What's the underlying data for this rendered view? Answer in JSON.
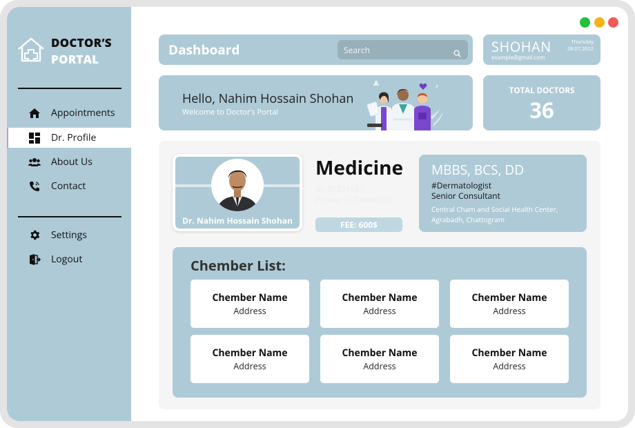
{
  "window_controls": [
    {
      "name": "maximize",
      "color": "#22c03c"
    },
    {
      "name": "minimize",
      "color": "#f5b21c"
    },
    {
      "name": "close",
      "color": "#f25a5a"
    }
  ],
  "brand": {
    "line1": "DOCTOR’S",
    "line2": "PORTAL",
    "icon": "house-cross-icon"
  },
  "sidebar": {
    "main_nav": [
      {
        "label": "Appointments",
        "icon": "home-icon",
        "active": false
      },
      {
        "label": "Dr. Profile",
        "icon": "dashboard-grid-icon",
        "active": true
      },
      {
        "label": "About Us",
        "icon": "users-icon",
        "active": false
      },
      {
        "label": "Contact",
        "icon": "phone-icon",
        "active": false
      }
    ],
    "bottom_nav": [
      {
        "label": "Settings",
        "icon": "gear-icon"
      },
      {
        "label": "Logout",
        "icon": "logout-icon"
      }
    ]
  },
  "header": {
    "title": "Dashboard",
    "search_placeholder": "Search"
  },
  "user": {
    "name": "SHOHAN",
    "email": "example@gmail.com",
    "day": "Thursday",
    "date": "28.07.2022"
  },
  "welcome": {
    "greeting": "Hello, Nahim Hossain Shohan",
    "subtitle": "Welcome to Doctor’s Portal"
  },
  "stats": {
    "total_doctors_label": "TOTAL DOCTORS",
    "total_doctors_value": "36"
  },
  "profile": {
    "doctor_name": "Dr. Nahim Hossain Shohan",
    "specialty": "Medicine",
    "faint_line_1": "ID: 01234567",
    "faint_line_2": "Phone: 01700000000",
    "fee": "FEE: 600$",
    "degrees": "MBBS, BCS, DD",
    "tag": "#Dermatologist",
    "position": "Senior Consultant",
    "address_line1": "Central Cham and Social Health Center,",
    "address_line2": "Agrabadh, Chattogram"
  },
  "chambers": {
    "heading": "Chember List:",
    "items": [
      {
        "name": "Chember Name",
        "address": "Address"
      },
      {
        "name": "Chember Name",
        "address": "Address"
      },
      {
        "name": "Chember Name",
        "address": "Address"
      },
      {
        "name": "Chember Name",
        "address": "Address"
      },
      {
        "name": "Chember Name",
        "address": "Address"
      },
      {
        "name": "Chember Name",
        "address": "Address"
      }
    ]
  },
  "colors": {
    "accent": "#aecad6",
    "panel_bg": "#f5f5f5",
    "active_nav_border": "#b99ae0"
  }
}
